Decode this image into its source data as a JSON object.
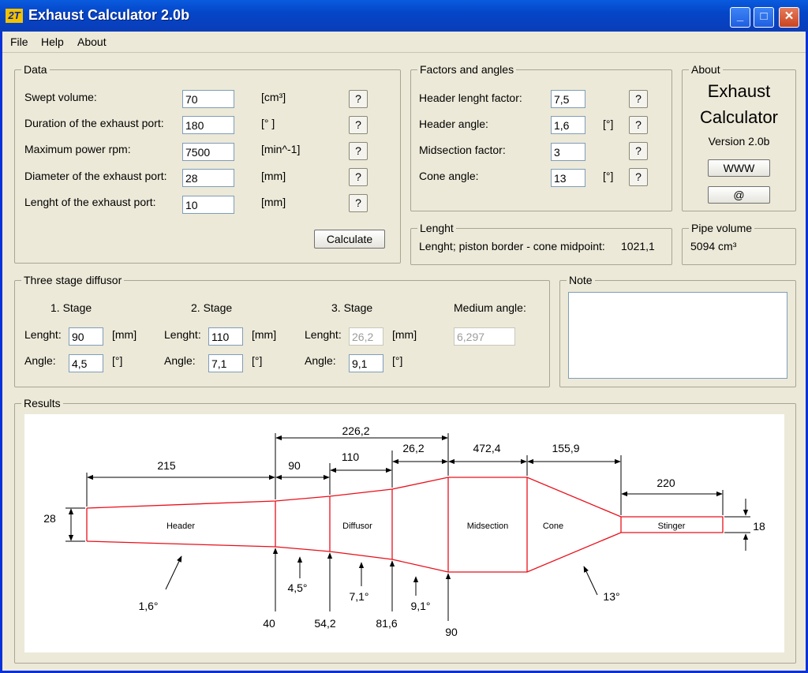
{
  "titlebar": {
    "app_icon": "2T",
    "title": "Exhaust Calculator 2.0b",
    "min": "_",
    "max": "□",
    "close": "✕"
  },
  "menu": {
    "file": "File",
    "help": "Help",
    "about": "About"
  },
  "data_group": {
    "title": "Data",
    "rows": [
      {
        "label": "Swept volume:",
        "value": "70",
        "unit": "[cm³]",
        "help": "?"
      },
      {
        "label": "Duration of the exhaust port:",
        "value": "180",
        "unit": "[° ]",
        "help": "?"
      },
      {
        "label": "Maximum power rpm:",
        "value": "7500",
        "unit": "[min^-1]",
        "help": "?"
      },
      {
        "label": "Diameter of the exhaust port:",
        "value": "28",
        "unit": "[mm]",
        "help": "?"
      },
      {
        "label": "Lenght of the exhaust port:",
        "value": "10",
        "unit": "[mm]",
        "help": "?"
      }
    ],
    "calculate": "Calculate"
  },
  "factors_group": {
    "title": "Factors and angles",
    "rows": [
      {
        "label": "Header lenght factor:",
        "value": "7,5",
        "unit": "",
        "help": "?"
      },
      {
        "label": "Header angle:",
        "value": "1,6",
        "unit": "[°]",
        "help": "?"
      },
      {
        "label": "Midsection factor:",
        "value": "3",
        "unit": "",
        "help": "?"
      },
      {
        "label": "Cone angle:",
        "value": "13",
        "unit": "[°]",
        "help": "?"
      }
    ]
  },
  "about_group": {
    "title": "About",
    "line1": "Exhaust",
    "line2": "Calculator",
    "version": "Version 2.0b",
    "www": "WWW",
    "email": "@"
  },
  "length_group": {
    "title": "Lenght",
    "text": "Lenght; piston border - cone midpoint:",
    "value": "1021,1"
  },
  "pipe_group": {
    "title": "Pipe volume",
    "value": "5094 cm³"
  },
  "diffusor_group": {
    "title": "Three stage diffusor",
    "stage1": {
      "head": "1. Stage",
      "len_label": "Lenght:",
      "len": "90",
      "len_unit": "[mm]",
      "ang_label": "Angle:",
      "ang": "4,5",
      "ang_unit": "[°]"
    },
    "stage2": {
      "head": "2. Stage",
      "len_label": "Lenght:",
      "len": "110",
      "len_unit": "[mm]",
      "ang_label": "Angle:",
      "ang": "7,1",
      "ang_unit": "[°]"
    },
    "stage3": {
      "head": "3. Stage",
      "len_label": "Lenght:",
      "len": "26,2",
      "len_unit": "[mm]",
      "ang_label": "Angle:",
      "ang": "9,1",
      "ang_unit": "[°]"
    },
    "medium": {
      "head": "Medium angle:",
      "value": "6,297"
    }
  },
  "note_group": {
    "title": "Note"
  },
  "results_group": {
    "title": "Results",
    "dims": {
      "header": "215",
      "stage1": "90",
      "stage2": "110",
      "stage3": "26,2",
      "diffusor_total": "226,2",
      "midsection": "472,4",
      "cone": "155,9",
      "stinger": "220",
      "inlet_dia": "28",
      "outlet_dia": "18"
    },
    "labels": {
      "header": "Header",
      "diffusor": "Diffusor",
      "midsection": "Midsection",
      "cone": "Cone",
      "stinger": "Stinger"
    },
    "angles": {
      "header": "1,6°",
      "stage1": "4,5°",
      "stage2": "7,1°",
      "stage3": "9,1°",
      "cone": "13°"
    },
    "diameters": {
      "d1": "40",
      "d2": "54,2",
      "d3": "81,6",
      "d4": "90"
    },
    "colors": {
      "pipe": "#e8101a",
      "dim": "#000000"
    }
  }
}
